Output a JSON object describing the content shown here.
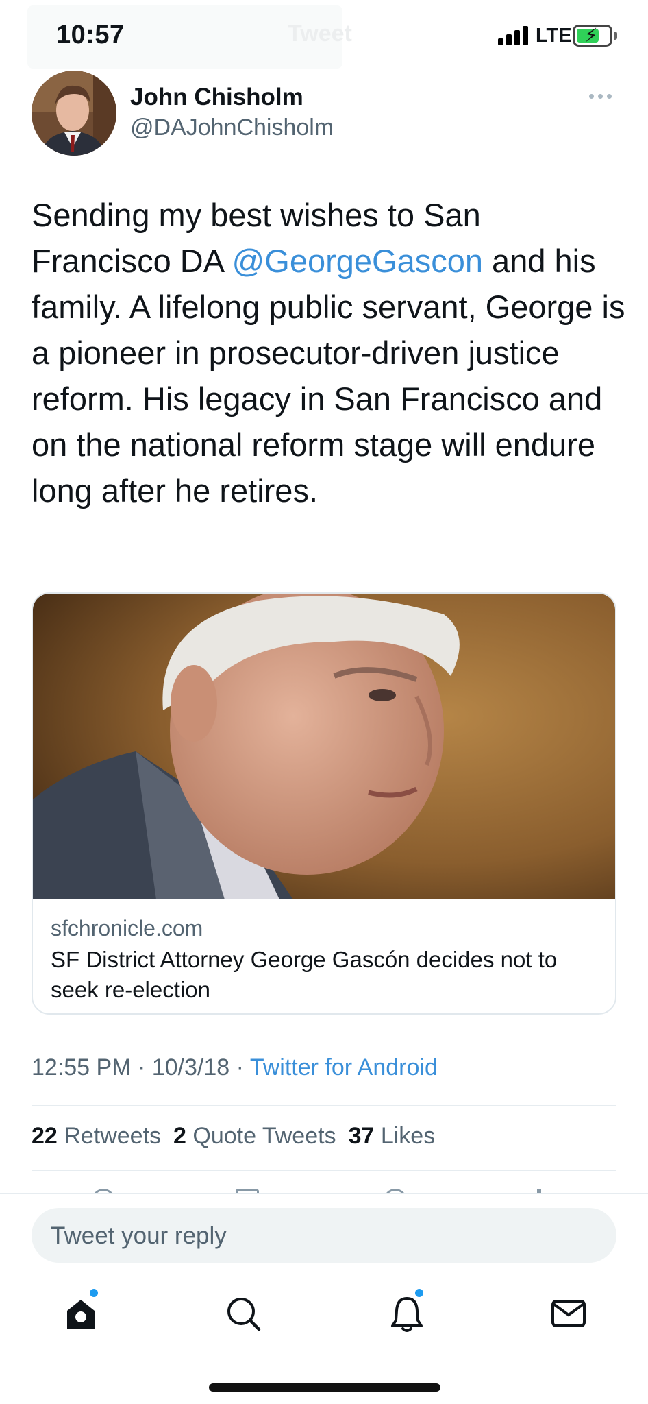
{
  "status_bar": {
    "time": "10:57",
    "network": "LTE",
    "ghost_header_title": "Tweet"
  },
  "tweet": {
    "author_name": "John Chisholm",
    "author_handle": "@DAJohnChisholm",
    "text_before": "Sending my best wishes to San Francisco DA ",
    "mention": "@GeorgeGascon",
    "text_after": " and his family. A lifelong public servant, George is a pioneer in prosecutor-driven justice reform. His legacy in San Francisco and on the national reform stage will endure long after he retires.",
    "card": {
      "domain": "sfchronicle.com",
      "title": "SF District Attorney George Gascón decides not to seek re-election"
    },
    "time": "12:55 PM",
    "date": "10/3/18",
    "separator": "·",
    "source": "Twitter for Android",
    "stats": {
      "retweets_count": "22",
      "retweets_label": "Retweets",
      "quote_count": "2",
      "quote_label": "Quote Tweets",
      "likes_count": "37",
      "likes_label": "Likes"
    }
  },
  "reply": {
    "placeholder": "Tweet your reply"
  },
  "tab_bar": {
    "items": [
      "home-icon",
      "search-icon",
      "notifications-icon",
      "messages-icon"
    ]
  },
  "colors": {
    "link": "#3a8fd9",
    "secondary_text": "#536471",
    "badge": "#1d9bf0"
  }
}
